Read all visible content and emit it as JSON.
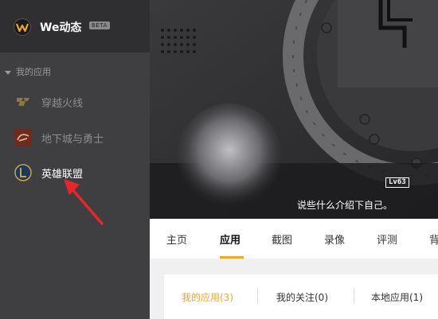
{
  "brand": {
    "name": "We动态",
    "badge": "BETA",
    "icon": "we-logo-icon"
  },
  "sidebar": {
    "section_title": "我的应用",
    "items": [
      {
        "label": "穿越火线",
        "icon": "crossfire-icon"
      },
      {
        "label": "地下城与勇士",
        "icon": "dnf-icon"
      },
      {
        "label": "英雄联盟",
        "icon": "lol-icon"
      }
    ]
  },
  "profile": {
    "level": "Lv63",
    "bio": "说些什么介绍下自己。"
  },
  "tabs": [
    "主页",
    "应用",
    "截图",
    "录像",
    "评测",
    "背"
  ],
  "subtabs": [
    "我的应用(3)",
    "我的关注(0)",
    "本地应用(1)"
  ],
  "colors": {
    "accent": "#f5a623",
    "sidebar": "#3f3f42",
    "brand_bar": "#2f2f31"
  }
}
